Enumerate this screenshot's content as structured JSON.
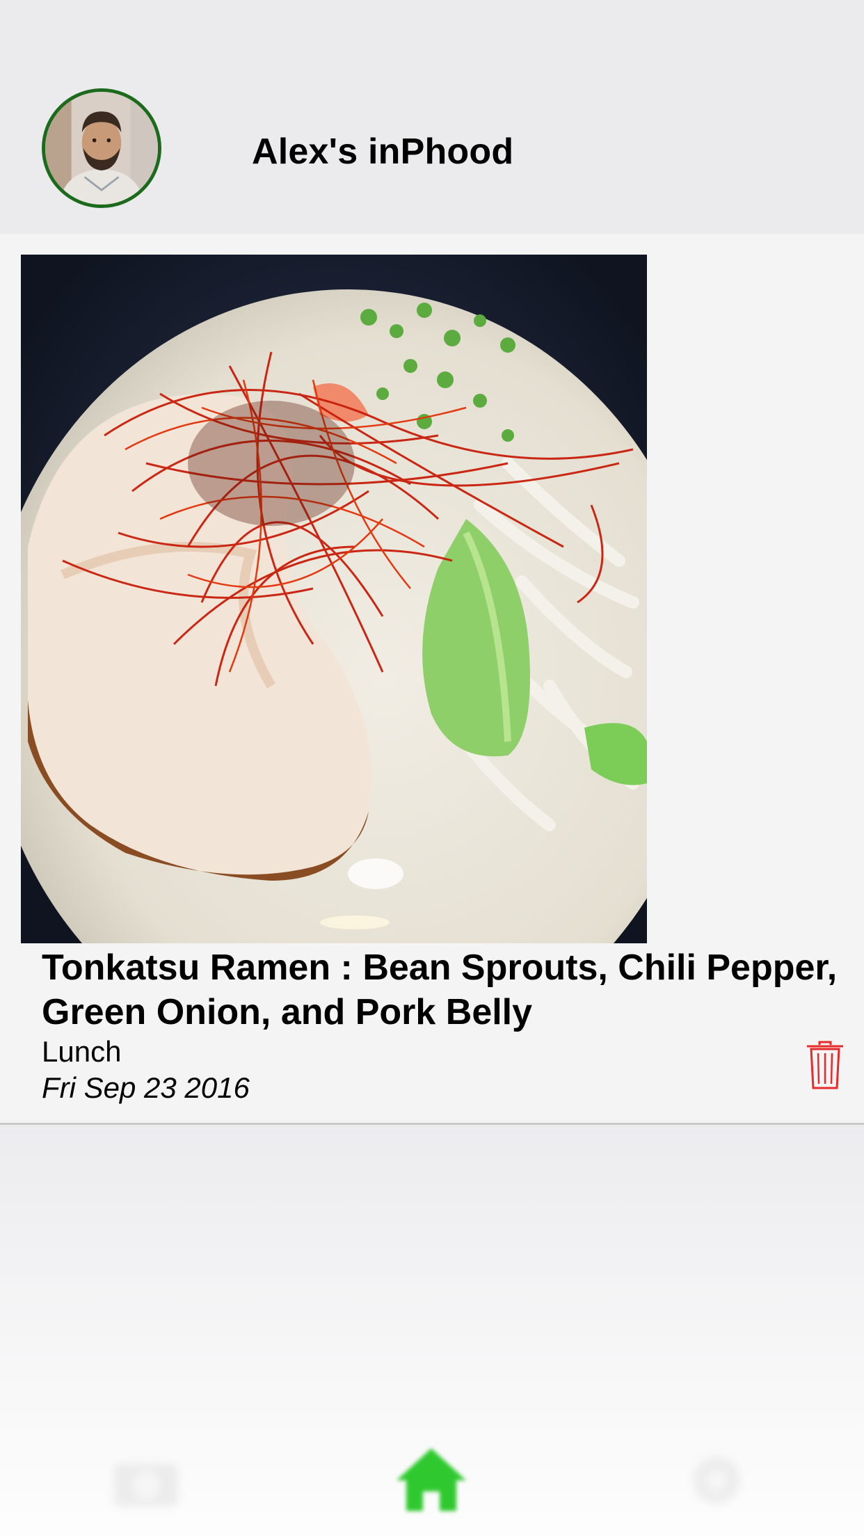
{
  "header": {
    "title": "Alex's inPhood",
    "avatar_icon": "user-avatar-photo"
  },
  "meal": {
    "name": "Tonkatsu Ramen : Bean Sprouts, Chili Pepper, Green Onion, and Pork Belly",
    "type": "Lunch",
    "date": "Fri Sep 23 2016",
    "photo_icon": "food-photo",
    "delete_icon": "trash-icon"
  },
  "tab_bar": {
    "items": [
      {
        "icon": "camera-icon",
        "active": false
      },
      {
        "icon": "home-icon",
        "active": true
      },
      {
        "icon": "settings-icon",
        "active": false
      }
    ]
  },
  "colors": {
    "accent": "#2fc92f",
    "avatar_ring": "#1c6a1c",
    "delete": "#e52b2b",
    "header_bg": "#ebebee"
  }
}
